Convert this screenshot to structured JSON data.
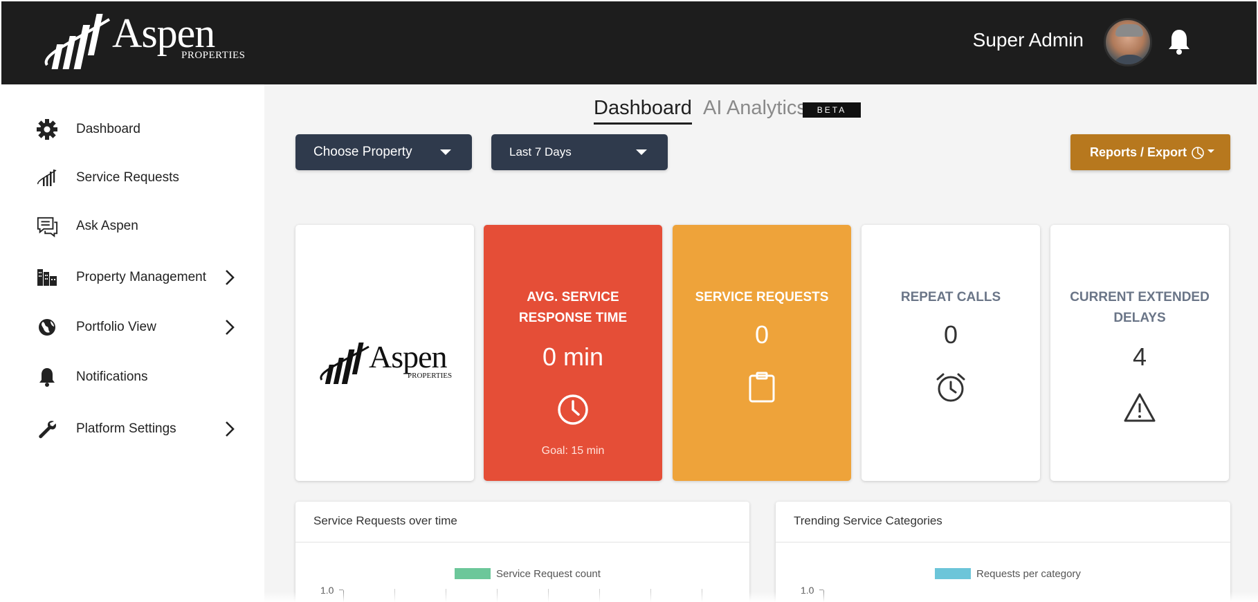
{
  "header": {
    "logo_text": "Aspen",
    "logo_subtext": "PROPERTIES",
    "user_name": "Super Admin"
  },
  "sidebar": {
    "items": [
      {
        "label": "Dashboard",
        "icon": "gear-icon",
        "has_submenu": false
      },
      {
        "label": "Service Requests",
        "icon": "aspen-mark-icon",
        "has_submenu": false
      },
      {
        "label": "Ask Aspen",
        "icon": "chat-icon",
        "has_submenu": false
      },
      {
        "label": "Property Management",
        "icon": "buildings-icon",
        "has_submenu": true
      },
      {
        "label": "Portfolio View",
        "icon": "globe-icon",
        "has_submenu": true
      },
      {
        "label": "Notifications",
        "icon": "bell-icon",
        "has_submenu": false
      },
      {
        "label": "Platform Settings",
        "icon": "wrench-icon",
        "has_submenu": true
      }
    ]
  },
  "tabs": {
    "dashboard": "Dashboard",
    "ai_analytics": "AI Analytics",
    "beta_badge": "BETA"
  },
  "filters": {
    "property": "Choose Property",
    "period": "Last 7 Days",
    "reports": "Reports / Export"
  },
  "cards": {
    "logo": {
      "text": "Aspen",
      "subtext": "PROPERTIES"
    },
    "avg_response": {
      "title_line1": "AVG. SERVICE",
      "title_line2": "RESPONSE TIME",
      "value": "0 min",
      "goal": "Goal: 15 min",
      "color": "#e54e37"
    },
    "service_requests": {
      "title": "SERVICE REQUESTS",
      "value": "0",
      "color": "#eea33a"
    },
    "repeat_calls": {
      "title": "REPEAT CALLS",
      "value": "0"
    },
    "extended_delays": {
      "title_line1": "CURRENT EXTENDED",
      "title_line2": "DELAYS",
      "value": "4"
    }
  },
  "panels": {
    "over_time": {
      "title": "Service Requests over time",
      "legend": "Service Request count",
      "legend_color": "#6cc79a",
      "y_tick": "1.0"
    },
    "categories": {
      "title": "Trending Service Categories",
      "legend": "Requests per category",
      "legend_color": "#6cc5d9",
      "y_tick": "1.0"
    }
  },
  "colors": {
    "topbar": "#1d1d1d",
    "select_bg": "#2f3a4c",
    "reports_bg": "#b7781e",
    "muted_text": "#6a7587"
  }
}
